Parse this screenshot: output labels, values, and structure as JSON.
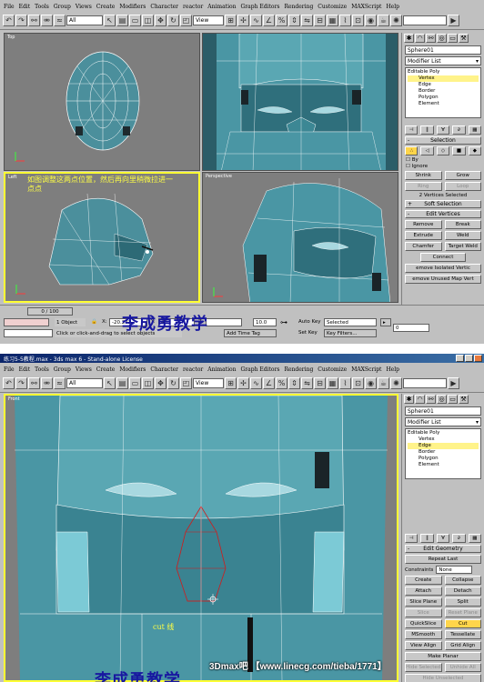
{
  "shot1": {
    "menu": [
      "File",
      "Edit",
      "Tools",
      "Group",
      "Views",
      "Create",
      "Modifiers",
      "Character",
      "reactor",
      "Animation",
      "Graph Editors",
      "Rendering",
      "Customize",
      "MAXScript",
      "Help"
    ],
    "toolbar": {
      "filter": "All",
      "refcoord": "View"
    },
    "viewports": {
      "top": "Top",
      "left": "Left",
      "perspective": "Perspective"
    },
    "annotation": "如图调整这两点位置，然后再向里稍微拉进一点点",
    "watermark": "李成勇教学",
    "panel": {
      "object_name": "Sphere01",
      "modifier_list": "Modifier List",
      "stack": [
        "Editable Poly",
        "Vertex",
        "Edge",
        "Border",
        "Polygon",
        "Element"
      ],
      "selected_index": 1,
      "selection_header": "Selection",
      "by_label": "By",
      "ignore_label": "Ignore",
      "shrink": "Shrink",
      "grow": "Grow",
      "ring": "Ring",
      "loop": "Loop",
      "selected_count": "2 Vertices Selected",
      "soft_selection": "Soft Selection",
      "edit_vertices": "Edit Vertices",
      "remove": "Remove",
      "break": "Break",
      "extrude": "Extrude",
      "weld": "Weld",
      "chamfer": "Chamfer",
      "target_weld": "Target Weld",
      "connect": "Connect",
      "remove_isolated": "emove Isolated Vertic",
      "remove_unused": "emove Unused Map Vert"
    },
    "status": {
      "frame": "0 / 100",
      "objects": "1 Object",
      "prompt": "Click or click-and-drag to select objects",
      "x_label": "X:",
      "x_value": "-20.273",
      "y_label": "Y:",
      "y_value": "46",
      "z_label": "Z:",
      "grid": "10.0",
      "add_time_tag": "Add Time Tag",
      "autokey": "Auto Key",
      "selected": "Selected",
      "setkey": "Set Key",
      "keyfilters": "Key Filters...",
      "frame_field": "0"
    }
  },
  "shot2": {
    "window_title": "练习5-5教程.max - 3ds max 6 - Stand-alone License",
    "menu": [
      "File",
      "Edit",
      "Tools",
      "Group",
      "Views",
      "Create",
      "Modifiers",
      "Character",
      "reactor",
      "Animation",
      "Graph Editors",
      "Rendering",
      "Customize",
      "MAXScript",
      "Help"
    ],
    "toolbar": {
      "filter": "All",
      "refcoord": "View"
    },
    "viewport": "Front",
    "annotation": "cut 线",
    "watermark": "李成勇教学",
    "footer": "3Dmax吧 【www.linecg.com/tieba/1771】",
    "panel": {
      "object_name": "Sphere01",
      "modifier_list": "Modifier List",
      "stack": [
        "Editable Poly",
        "Vertex",
        "Edge",
        "Border",
        "Polygon",
        "Element"
      ],
      "selected_index": 2,
      "edit_geometry": "Edit Geometry",
      "repeat_last": "Repeat Last",
      "constraints_label": "Constraints",
      "constraints_value": "None",
      "create": "Create",
      "collapse": "Collapse",
      "attach": "Attach",
      "detach": "Detach",
      "slice_plane": "Slice Plane",
      "split": "Split",
      "slice": "Slice",
      "reset_plane": "Reset Plane",
      "quickslice": "QuickSlice",
      "cut": "Cut",
      "msmooth": "MSmooth",
      "tessellate": "Tessellate",
      "view_align": "View Align",
      "grid_align": "Grid Align",
      "make_planar": "Make Planar",
      "hide_selected": "Hide Selected",
      "unhide_all": "Unhide All",
      "hide_unselected": "Hide Unselected"
    }
  }
}
